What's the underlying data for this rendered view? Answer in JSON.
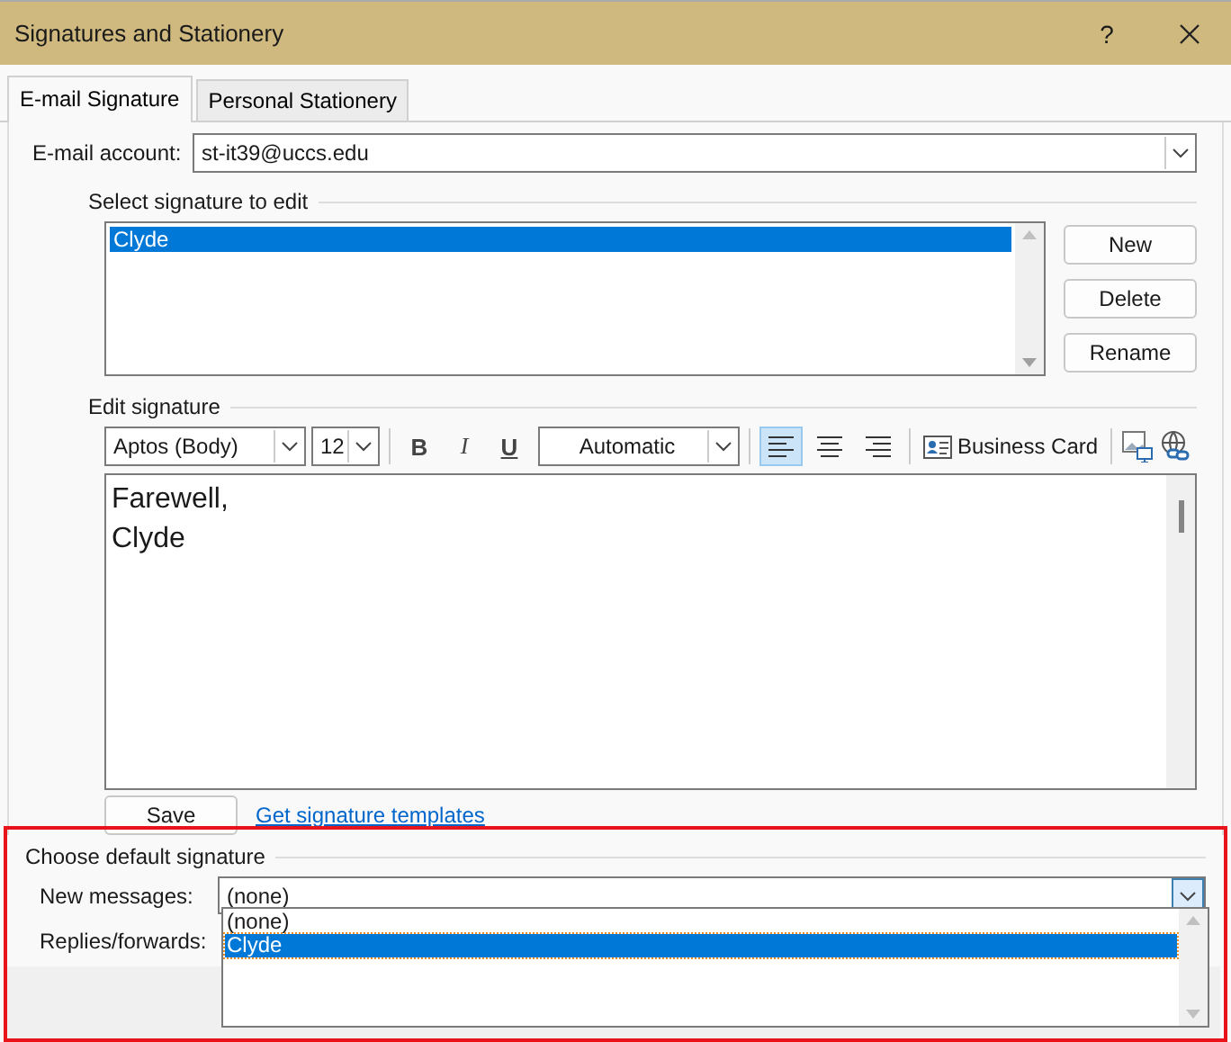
{
  "window": {
    "title": "Signatures and Stationery",
    "help": "?"
  },
  "tabs": [
    {
      "label": "E-mail Signature",
      "selected": true
    },
    {
      "label": "Personal Stationery",
      "selected": false
    }
  ],
  "account": {
    "label": "E-mail account:",
    "value": "st-it39@uccs.edu"
  },
  "select_section": {
    "title": "Select signature to edit",
    "signatures": [
      {
        "name": "Clyde",
        "selected": true
      }
    ],
    "buttons": [
      "New",
      "Delete",
      "Rename"
    ]
  },
  "edit_section": {
    "title": "Edit signature",
    "font": "Aptos (Body)",
    "size": "12",
    "format_buttons": [
      {
        "kind": "bold",
        "label": "B"
      },
      {
        "kind": "italic",
        "label": "I"
      },
      {
        "kind": "underline",
        "label": "U"
      }
    ],
    "font_color": "Automatic",
    "alignment": [
      {
        "kind": "left",
        "selected": true
      },
      {
        "kind": "center",
        "selected": false
      },
      {
        "kind": "right",
        "selected": false
      }
    ],
    "business_card": "Business Card",
    "body_lines": [
      "Farewell,",
      "Clyde"
    ],
    "save": "Save",
    "templates_link": "Get signature templates"
  },
  "default_section": {
    "title": "Choose default signature",
    "new_messages": {
      "label": "New messages:",
      "value": "(none)",
      "expanded": true,
      "options": [
        {
          "label": "(none)",
          "highlighted": false
        },
        {
          "label": "Clyde",
          "highlighted": true
        }
      ]
    },
    "replies": {
      "label": "Replies/forwards:"
    }
  }
}
